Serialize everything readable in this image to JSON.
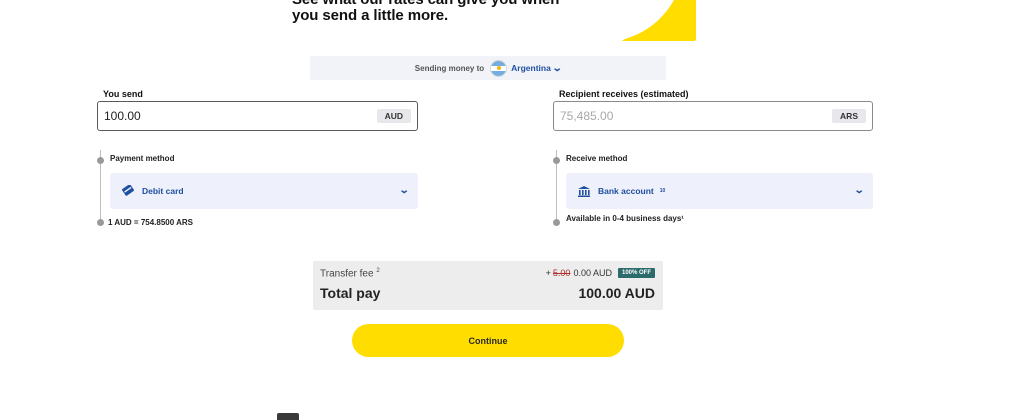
{
  "hero": {
    "line1": "See what our rates can give you when",
    "line2": "you send a little more."
  },
  "destination": {
    "prefix": "Sending money to",
    "country": "Argentina",
    "flag_icon": "argentina-flag-icon"
  },
  "send": {
    "label": "You send",
    "value": "100.00",
    "currency": "AUD"
  },
  "receive": {
    "label": "Recipient receives (estimated)",
    "placeholder": "75,485.00",
    "currency": "ARS"
  },
  "payment_method": {
    "label": "Payment method",
    "value": "Debit card",
    "icon": "card-icon"
  },
  "rate": {
    "text": "1 AUD = 754.8500 ARS"
  },
  "receive_method": {
    "label": "Receive method",
    "value": "Bank account",
    "superscript": "10",
    "icon": "bank-icon",
    "availability": "Available in 0-4 business days¹"
  },
  "fees": {
    "transfer_fee_label": "Transfer fee",
    "transfer_fee_sup": "2",
    "plus_sign": "+",
    "original_fee": "5.00",
    "fee_value": "0.00 AUD",
    "badge": "100% OFF",
    "total_label": "Total pay",
    "total_value": "100.00 AUD"
  },
  "continue_label": "Continue",
  "colors": {
    "brand_yellow": "#ffdd00",
    "link_blue": "#1f4fa0",
    "method_bg": "#eef0fb",
    "badge_teal": "#2b6b6b"
  }
}
